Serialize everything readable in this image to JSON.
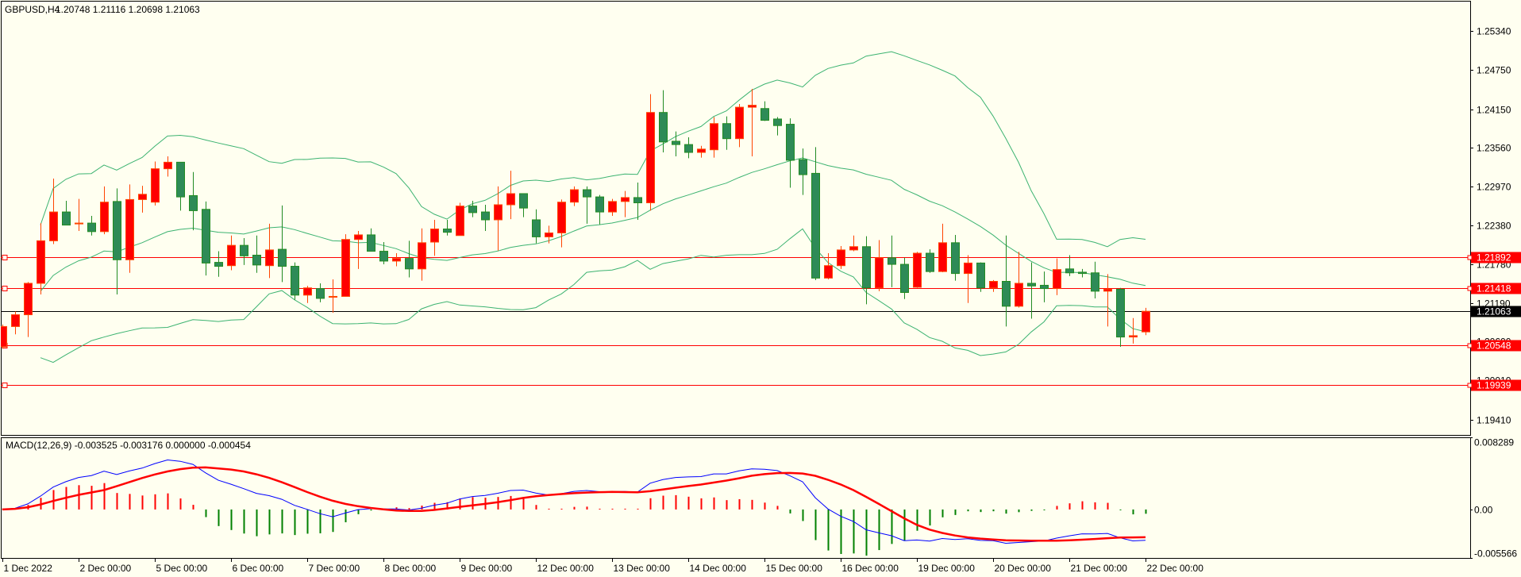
{
  "header": {
    "symbol": "GBPUSD,H4",
    "ohlc": "1.20748 1.21116 1.20698 1.21063"
  },
  "macd_legend": "MACD(12,26,9) -0.003525 -0.003176 0.000000 -0.000454",
  "colors": {
    "background": "#FFFFF0",
    "bull_body": "#FF0000",
    "bull_edge": "#FF4500",
    "bear_body": "#2E8B57",
    "bear_edge": "#228B22",
    "bands": "#3CB371",
    "macd_main": "#0000FF",
    "macd_signal": "#FF0000",
    "hist_pos": "#FF0000",
    "hist_neg": "#008000",
    "level_line": "#FF0000",
    "bid_line": "#000000"
  },
  "chart_data": {
    "type": "candlestick",
    "title": "GBPUSD,H4",
    "price_range": [
      1.1912,
      1.25818
    ],
    "price_ticks": [
      "1.25340",
      "1.24750",
      "1.24150",
      "1.23560",
      "1.22970",
      "1.22380",
      "1.21780",
      "1.21190",
      "1.20600",
      "1.20010",
      "1.19410"
    ],
    "levels": [
      {
        "label": "1.21892",
        "value": 1.21892
      },
      {
        "label": "1.21418",
        "value": 1.21418
      },
      {
        "label": "1.20548",
        "value": 1.20548
      },
      {
        "label": "1.19939",
        "value": 1.19939
      }
    ],
    "bid": {
      "label": "1.21063",
      "value": 1.21063
    },
    "time_labels": [
      {
        "bar": 0,
        "label": "1 Dec 2022"
      },
      {
        "bar": 6,
        "label": "2 Dec 00:00"
      },
      {
        "bar": 12,
        "label": "5 Dec 00:00"
      },
      {
        "bar": 18,
        "label": "6 Dec 00:00"
      },
      {
        "bar": 24,
        "label": "7 Dec 00:00"
      },
      {
        "bar": 30,
        "label": "8 Dec 00:00"
      },
      {
        "bar": 36,
        "label": "9 Dec 00:00"
      },
      {
        "bar": 42,
        "label": "12 Dec 00:00"
      },
      {
        "bar": 48,
        "label": "13 Dec 00:00"
      },
      {
        "bar": 54,
        "label": "14 Dec 00:00"
      },
      {
        "bar": 60,
        "label": "15 Dec 00:00"
      },
      {
        "bar": 66,
        "label": "16 Dec 00:00"
      },
      {
        "bar": 72,
        "label": "19 Dec 00:00"
      },
      {
        "bar": 78,
        "label": "20 Dec 00:00"
      },
      {
        "bar": 84,
        "label": "21 Dec 00:00"
      },
      {
        "bar": 90,
        "label": "22 Dec 00:00"
      }
    ],
    "ohlc": [
      [
        1.2052,
        1.2086,
        1.2049,
        1.2083
      ],
      [
        1.2083,
        1.2106,
        1.2071,
        1.2101
      ],
      [
        1.2101,
        1.2151,
        1.2067,
        1.2149
      ],
      [
        1.2149,
        1.2241,
        1.2132,
        1.2214
      ],
      [
        1.2214,
        1.2309,
        1.2209,
        1.2258
      ],
      [
        1.2258,
        1.2275,
        1.2238,
        1.2238
      ],
      [
        1.224,
        1.2278,
        1.2229,
        1.2241
      ],
      [
        1.2241,
        1.2252,
        1.2222,
        1.2228
      ],
      [
        1.2228,
        1.2297,
        1.2224,
        1.2273
      ],
      [
        1.2274,
        1.2294,
        1.2132,
        1.2185
      ],
      [
        1.2185,
        1.23,
        1.2165,
        1.2277
      ],
      [
        1.2277,
        1.2298,
        1.2257,
        1.2285
      ],
      [
        1.2273,
        1.2335,
        1.2268,
        1.2324
      ],
      [
        1.2324,
        1.2343,
        1.2312,
        1.2334
      ],
      [
        1.2334,
        1.2334,
        1.226,
        1.2281
      ],
      [
        1.2283,
        1.2319,
        1.223,
        1.226
      ],
      [
        1.2262,
        1.2274,
        1.2161,
        1.218
      ],
      [
        1.2181,
        1.2198,
        1.2159,
        1.2175
      ],
      [
        1.2176,
        1.2222,
        1.2169,
        1.2207
      ],
      [
        1.2207,
        1.2218,
        1.2177,
        1.2191
      ],
      [
        1.2192,
        1.2222,
        1.2165,
        1.2177
      ],
      [
        1.2176,
        1.224,
        1.2157,
        1.22
      ],
      [
        1.2201,
        1.2268,
        1.2151,
        1.2175
      ],
      [
        1.2175,
        1.2181,
        1.2124,
        1.2131
      ],
      [
        1.2131,
        1.2145,
        1.2119,
        1.2142
      ],
      [
        1.2141,
        1.2149,
        1.212,
        1.2126
      ],
      [
        1.2128,
        1.2155,
        1.2104,
        1.2129
      ],
      [
        1.2129,
        1.2224,
        1.2129,
        1.2216
      ],
      [
        1.2216,
        1.2229,
        1.2171,
        1.2223
      ],
      [
        1.2223,
        1.2233,
        1.2198,
        1.2198
      ],
      [
        1.2198,
        1.2212,
        1.2178,
        1.2183
      ],
      [
        1.2183,
        1.2195,
        1.2175,
        1.2187
      ],
      [
        1.2187,
        1.2214,
        1.2158,
        1.2171
      ],
      [
        1.2171,
        1.2233,
        1.2153,
        1.2211
      ],
      [
        1.2212,
        1.2246,
        1.2191,
        1.2232
      ],
      [
        1.2232,
        1.2246,
        1.2222,
        1.2227
      ],
      [
        1.2222,
        1.2272,
        1.2222,
        1.2267
      ],
      [
        1.2267,
        1.2275,
        1.225,
        1.2257
      ],
      [
        1.2258,
        1.2269,
        1.2229,
        1.2246
      ],
      [
        1.2246,
        1.2297,
        1.2199,
        1.2269
      ],
      [
        1.2269,
        1.2321,
        1.2247,
        1.2286
      ],
      [
        1.2286,
        1.2286,
        1.225,
        1.2264
      ],
      [
        1.2246,
        1.2262,
        1.221,
        1.222
      ],
      [
        1.222,
        1.2237,
        1.221,
        1.2226
      ],
      [
        1.2226,
        1.2277,
        1.2204,
        1.2273
      ],
      [
        1.2273,
        1.2297,
        1.2267,
        1.2292
      ],
      [
        1.2292,
        1.2297,
        1.224,
        1.2281
      ],
      [
        1.2281,
        1.2284,
        1.2239,
        1.2258
      ],
      [
        1.2258,
        1.2278,
        1.2252,
        1.2274
      ],
      [
        1.2274,
        1.229,
        1.225,
        1.228
      ],
      [
        1.228,
        1.2303,
        1.2246,
        1.2272
      ],
      [
        1.2272,
        1.2438,
        1.226,
        1.241
      ],
      [
        1.241,
        1.2444,
        1.2349,
        1.2365
      ],
      [
        1.2366,
        1.2381,
        1.2343,
        1.2361
      ],
      [
        1.2361,
        1.2372,
        1.234,
        1.2349
      ],
      [
        1.2349,
        1.2359,
        1.2341,
        1.2354
      ],
      [
        1.2353,
        1.2403,
        1.2341,
        1.2393
      ],
      [
        1.2393,
        1.2404,
        1.2353,
        1.237
      ],
      [
        1.237,
        1.2423,
        1.2357,
        1.2418
      ],
      [
        1.2418,
        1.2446,
        1.2343,
        1.2421
      ],
      [
        1.2416,
        1.2427,
        1.2397,
        1.2398
      ],
      [
        1.24,
        1.2403,
        1.2375,
        1.239
      ],
      [
        1.2392,
        1.2401,
        1.2295,
        1.2337
      ],
      [
        1.2338,
        1.2355,
        1.2284,
        1.2315
      ],
      [
        1.2317,
        1.2357,
        1.2154,
        1.2157
      ],
      [
        1.2157,
        1.2195,
        1.2155,
        1.2176
      ],
      [
        1.2176,
        1.2206,
        1.2171,
        1.22
      ],
      [
        1.22,
        1.2222,
        1.2198,
        1.2205
      ],
      [
        1.2205,
        1.2221,
        1.2117,
        1.2142
      ],
      [
        1.2142,
        1.2215,
        1.2137,
        1.2188
      ],
      [
        1.2188,
        1.2222,
        1.2143,
        1.2178
      ],
      [
        1.2178,
        1.2188,
        1.2125,
        1.2135
      ],
      [
        1.2143,
        1.2197,
        1.2142,
        1.2195
      ],
      [
        1.2195,
        1.2201,
        1.2165,
        1.2167
      ],
      [
        1.2167,
        1.224,
        1.2166,
        1.2211
      ],
      [
        1.2211,
        1.2223,
        1.2153,
        1.2164
      ],
      [
        1.2164,
        1.2192,
        1.2119,
        1.218
      ],
      [
        1.218,
        1.2181,
        1.2136,
        1.2142
      ],
      [
        1.2142,
        1.2154,
        1.2136,
        1.2152
      ],
      [
        1.2152,
        1.2222,
        1.2083,
        1.2114
      ],
      [
        1.2114,
        1.2197,
        1.2112,
        1.2149
      ],
      [
        1.2149,
        1.2181,
        1.2095,
        1.2145
      ],
      [
        1.2146,
        1.2167,
        1.212,
        1.2141
      ],
      [
        1.2141,
        1.2187,
        1.2131,
        1.217
      ],
      [
        1.2171,
        1.2192,
        1.216,
        1.2165
      ],
      [
        1.2166,
        1.2171,
        1.2158,
        1.2164
      ],
      [
        1.2165,
        1.2182,
        1.2126,
        1.2137
      ],
      [
        1.2137,
        1.2163,
        1.2083,
        1.214
      ],
      [
        1.214,
        1.2142,
        1.2052,
        1.2067
      ],
      [
        1.2067,
        1.2096,
        1.2057,
        1.2069
      ],
      [
        1.20748,
        1.21116,
        1.20698,
        1.21063
      ]
    ],
    "indicators": {
      "bollinger": {
        "period": 20,
        "deviation": 2
      },
      "macd": {
        "fast": 12,
        "slow": 26,
        "signal": 9,
        "range": [
          -0.005566,
          0.008289
        ],
        "ticks": [
          "0.008289",
          "0.00",
          "-0.005566"
        ]
      }
    }
  }
}
